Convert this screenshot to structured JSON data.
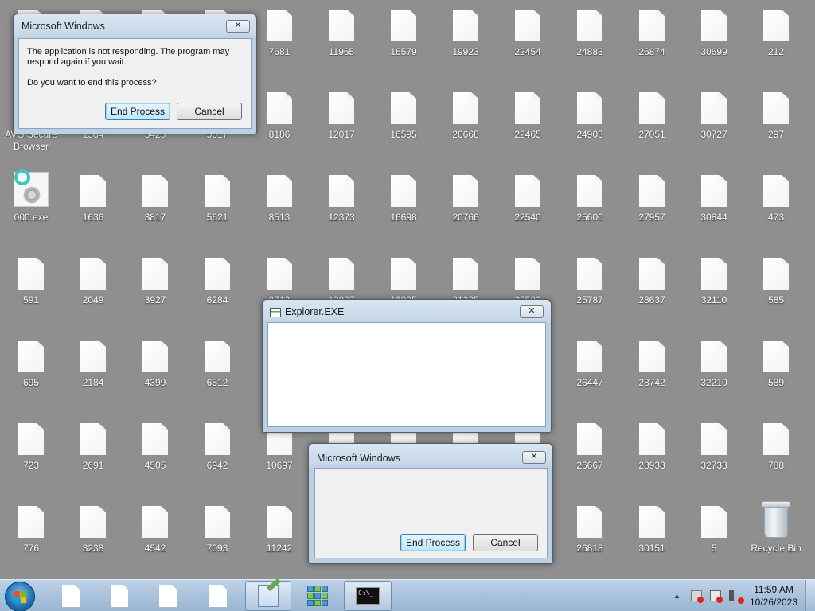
{
  "desktop": {
    "columns": [
      {
        "labels": [
          "",
          "AVG Secure\nBrowser",
          "000.exe",
          "591",
          "695",
          "723",
          "776"
        ]
      },
      {
        "labels": [
          "",
          "1384",
          "1636",
          "2049",
          "2184",
          "2691",
          "3238"
        ]
      },
      {
        "labels": [
          "",
          "3425",
          "3817",
          "3927",
          "4399",
          "4505",
          "4542"
        ]
      },
      {
        "labels": [
          "",
          "5617",
          "5621",
          "6284",
          "6512",
          "6942",
          "7093"
        ]
      },
      {
        "labels": [
          "7681",
          "8186",
          "8513",
          "8713",
          "",
          "10697",
          "11242"
        ]
      },
      {
        "labels": [
          "11965",
          "12017",
          "12373",
          "12997",
          "",
          "",
          ""
        ]
      },
      {
        "labels": [
          "16579",
          "16595",
          "16698",
          "16905",
          "",
          "",
          ""
        ]
      },
      {
        "labels": [
          "19923",
          "20668",
          "20766",
          "21325",
          "",
          "",
          ""
        ]
      },
      {
        "labels": [
          "22454",
          "22465",
          "22540",
          "22582",
          "",
          "",
          ""
        ]
      },
      {
        "labels": [
          "24883",
          "24903",
          "25600",
          "25787",
          "26447",
          "26667",
          "26818"
        ]
      },
      {
        "labels": [
          "26874",
          "27051",
          "27957",
          "28637",
          "28742",
          "28933",
          "30151"
        ]
      },
      {
        "labels": [
          "30699",
          "30727",
          "30844",
          "32110",
          "32210",
          "32733",
          "5"
        ]
      },
      {
        "labels": [
          "212",
          "297",
          "473",
          "585",
          "589",
          "788",
          "Recycle Bin"
        ]
      }
    ]
  },
  "dialog_not_responding": {
    "title": "Microsoft Windows",
    "close": "✕",
    "message": "The application is not responding. The program may respond again if you wait.",
    "question": "Do you want to end this process?",
    "end_button": "End Process",
    "cancel_button": "Cancel"
  },
  "explorer_window": {
    "title": "Explorer.EXE",
    "close": "✕"
  },
  "dialog_second": {
    "title": "Microsoft Windows",
    "close": "✕",
    "end_button": "End Process",
    "cancel_button": "Cancel"
  },
  "taskbar": {
    "cmd_text": "C:\\_",
    "clock_time": "11:59 AM",
    "clock_date": "10/26/2023",
    "tray_arrow": "▲",
    "icons": [
      "start-orb",
      "file",
      "file",
      "file",
      "file",
      "notepad",
      "app-grid",
      "cmd"
    ]
  },
  "colors": {
    "desktop_bg": "#8f8f8f",
    "taskbar": "#a9c2dc",
    "accent": "#3c7fb1"
  }
}
